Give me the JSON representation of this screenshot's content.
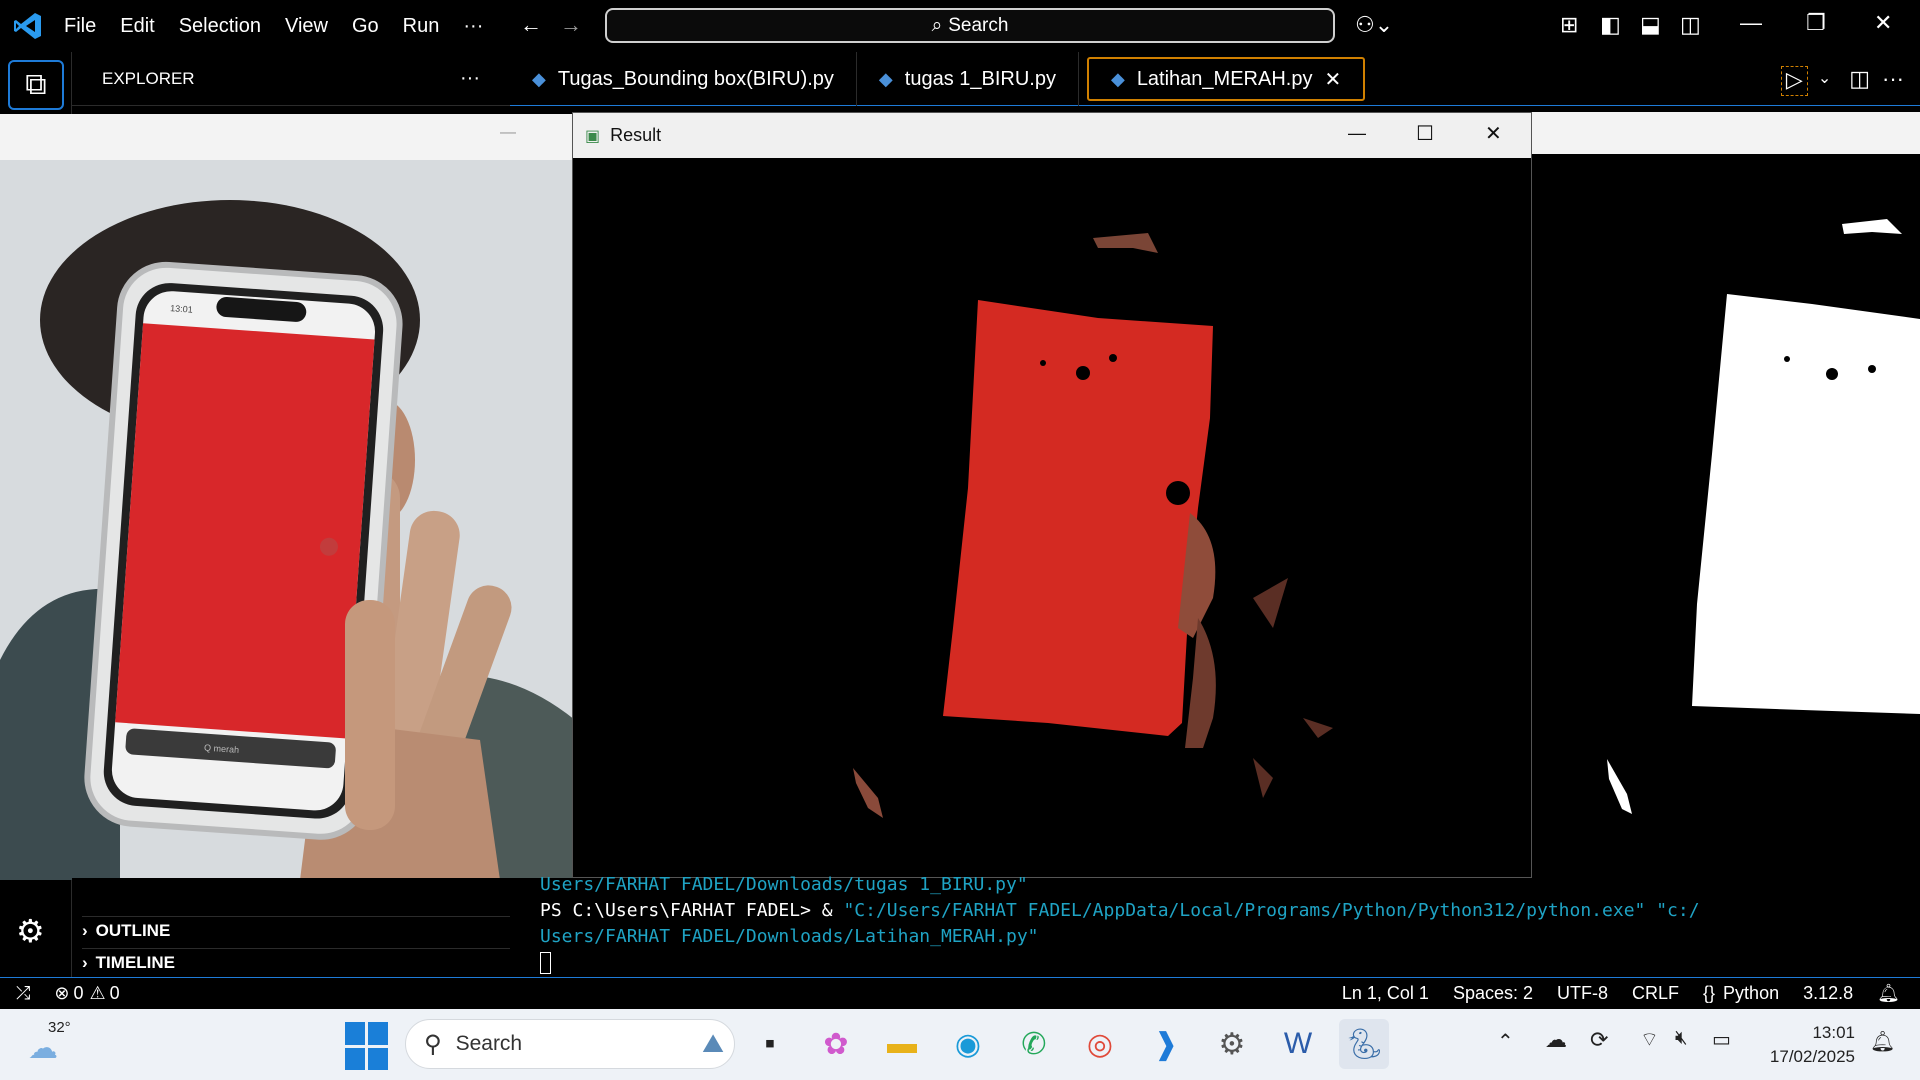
{
  "titlebar": {
    "menus": [
      "File",
      "Edit",
      "Selection",
      "View",
      "Go",
      "Run",
      "···"
    ],
    "search_label": "Search"
  },
  "sidebar": {
    "explorer_label": "EXPLORER",
    "outline_label": "OUTLINE",
    "timeline_label": "TIMELINE"
  },
  "tabs": [
    {
      "label": "Tugas_Bounding box(BIRU).py"
    },
    {
      "label": "tugas 1_BIRU.py"
    },
    {
      "label": "Latihan_MERAH.py"
    }
  ],
  "result_window": {
    "title": "Result"
  },
  "terminal": {
    "line1": "Users/FARHAT FADEL/Downloads/tugas 1_BIRU.py\"",
    "line2_prompt": "PS C:\\Users\\FARHAT FADEL> & ",
    "line2_path": "\"C:/Users/FARHAT FADEL/AppData/Local/Programs/Python/Python312/python.exe\" \"c:/",
    "line3": "Users/FARHAT FADEL/Downloads/Latihan_MERAH.py\""
  },
  "statusbar": {
    "errors": "0",
    "warnings": "0",
    "position": "Ln 1, Col 1",
    "spaces": "Spaces: 2",
    "encoding": "UTF-8",
    "eol": "CRLF",
    "language": "Python",
    "version": "3.12.8"
  },
  "taskbar": {
    "weather_temp": "32°",
    "search_label": "Search",
    "time": "13:01",
    "date": "17/02/2025"
  },
  "phone": {
    "status_time": "13:01",
    "url_text": "Q merah"
  },
  "colors": {
    "accent": "#1e7bd8",
    "tab_active_border": "#d08000",
    "detected_red": "#d42a22",
    "terminal_path": "#1fa3c4"
  }
}
